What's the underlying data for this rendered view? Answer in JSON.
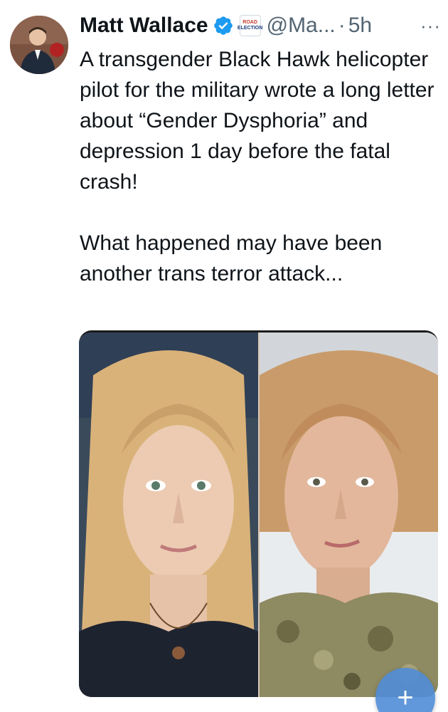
{
  "author": {
    "display_name": "Matt Wallace",
    "verified_icon": "verified-badge-icon",
    "affiliation_badge": {
      "line1": "ROAD",
      "line2": "ELECTION"
    },
    "handle": "@Ma...",
    "separator": "·",
    "time": "5h"
  },
  "more_label": "···",
  "tweet": {
    "text": "A transgender Black Hawk helicopter pilot for the military wrote a long letter about “Gender Dysphoria” and depression 1 day before the fatal crash!\n\nWhat happened may have been another trans terror attack..."
  },
  "compose_button": {
    "label": "+"
  },
  "colors": {
    "text": "#0f1419",
    "secondary": "#536471",
    "verified": "#1d9bf0",
    "fab": "#508cd7"
  }
}
